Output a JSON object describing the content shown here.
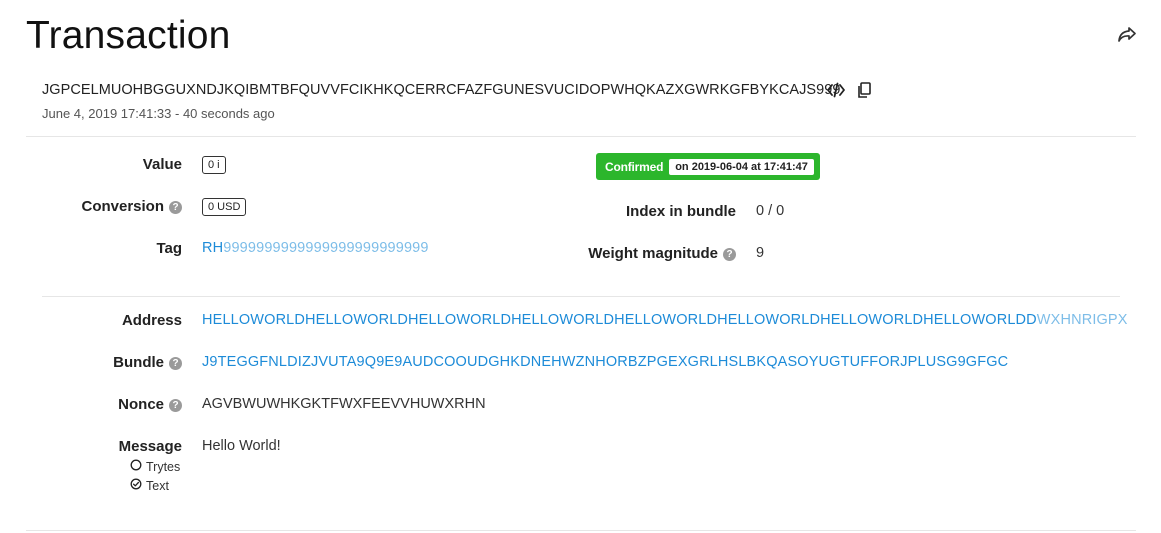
{
  "page": {
    "title": "Transaction",
    "hash": "JGPCELMUOHBGGUXNDJKQIBMTBFQUVVFCIKHKQCERRCFAZFGUNESVUCIDOPWHQKAZXGWRKGFBYKCAJS999",
    "date": "June 4, 2019 17:41:33 - 40 seconds ago"
  },
  "fields": {
    "value_label": "Value",
    "value": "0 i",
    "conversion_label": "Conversion",
    "conversion": "0 USD",
    "tag_label": "Tag",
    "tag_main": "RH",
    "tag_padding": "9999999999999999999999999",
    "status": "Confirmed",
    "status_date": "on 2019-06-04 at 17:41:47",
    "index_label": "Index in bundle",
    "index": "0 / 0",
    "weight_label": "Weight magnitude",
    "weight": "9"
  },
  "details": {
    "address_label": "Address",
    "address_main": "HELLOWORLDHELLOWORLDHELLOWORLDHELLOWORLDHELLOWORLDHELLOWORLDHELLOWORLDHELLOWORLDD",
    "address_checksum": "WXHNRIGPX",
    "bundle_label": "Bundle",
    "bundle": "J9TEGGFNLDIZJVUTA9Q9E9AUDCOOUDGHKDNEHWZNHORBZPGEXGRLHSLBKQASOYUGTUFFORJPLUSG9GFGC",
    "nonce_label": "Nonce",
    "nonce": "AGVBWUWHKGKTFWXFEEVVHUWXRHN",
    "message_label": "Message",
    "message": "Hello World!",
    "message_options": [
      "Trytes",
      "Text"
    ],
    "message_selected": "Text"
  },
  "icons": {
    "share": "share-icon",
    "code": "code-icon",
    "copy": "copy-icon",
    "help": "help-icon",
    "check": "check-circle-icon",
    "radio": "radio-empty-icon"
  },
  "colors": {
    "link": "#1d8bd8",
    "link_light": "#7dbde8",
    "confirmed": "#2cb62c"
  }
}
